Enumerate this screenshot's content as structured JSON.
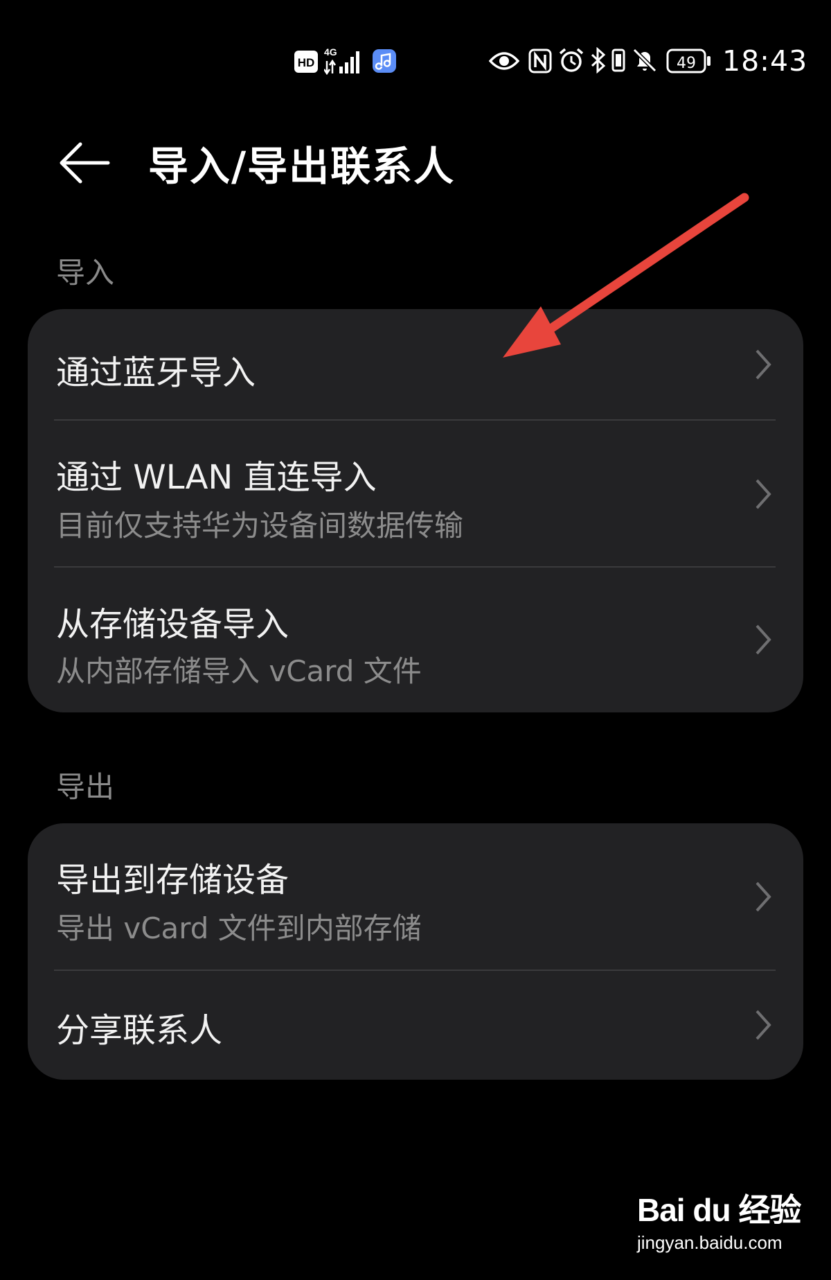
{
  "status_bar": {
    "hd_badge": "HD",
    "network": "4G",
    "battery_level": "49",
    "time": "18:43",
    "icons": [
      "hd-icon",
      "signal-4g-icon",
      "music-app-icon",
      "eye-icon",
      "nfc-icon",
      "alarm-icon",
      "bluetooth-icon",
      "vibrate-icon",
      "bell-off-icon",
      "battery-icon"
    ]
  },
  "header": {
    "back_icon": "back-arrow-icon",
    "title": "导入/导出联系人"
  },
  "import_section": {
    "label": "导入",
    "items": [
      {
        "title": "通过蓝牙导入",
        "subtitle": ""
      },
      {
        "title": "通过 WLAN 直连导入",
        "subtitle": "目前仅支持华为设备间数据传输"
      },
      {
        "title": "从存储设备导入",
        "subtitle": "从内部存储导入 vCard 文件"
      }
    ]
  },
  "export_section": {
    "label": "导出",
    "items": [
      {
        "title": "导出到存储设备",
        "subtitle": "导出 vCard 文件到内部存储"
      },
      {
        "title": "分享联系人",
        "subtitle": ""
      }
    ]
  },
  "watermark": {
    "logo": "Bai du 经验",
    "url": "jingyan.baidu.com"
  },
  "colors": {
    "background": "#000000",
    "card": "#222224",
    "annotation_arrow": "#e8453c",
    "secondary_text": "#8c8c8c"
  }
}
